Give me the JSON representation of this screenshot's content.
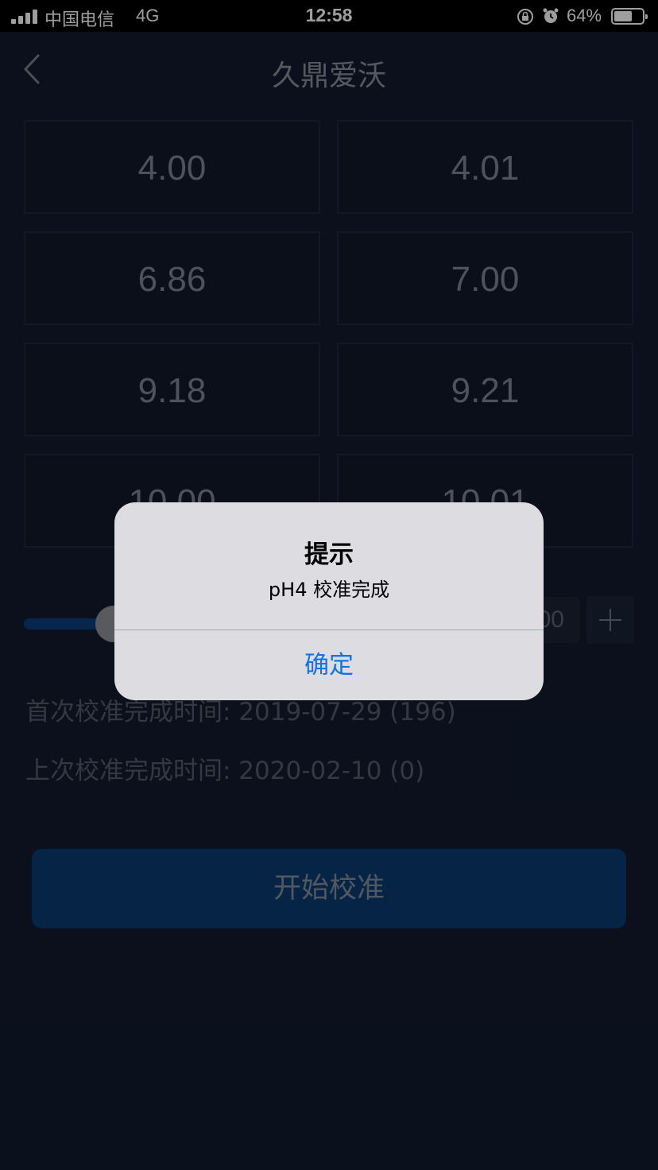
{
  "status_bar": {
    "carrier": "中国电信",
    "network": "4G",
    "time": "12:58",
    "battery_pct_text": "64%",
    "battery_level": 0.64
  },
  "nav": {
    "title": "久鼎爱沃"
  },
  "buffers": [
    "4.00",
    "4.01",
    "6.86",
    "7.00",
    "9.18",
    "9.21",
    "10.00",
    "10.01"
  ],
  "slider": {
    "value_text": "00"
  },
  "info": {
    "first_calibration": "首次校准完成时间: 2019-07-29 (196)",
    "last_calibration": "上次校准完成时间: 2020-02-10 (0)"
  },
  "start_button": {
    "label": "开始校准"
  },
  "dialog": {
    "title": "提示",
    "message": "pH4 校准完成",
    "confirm_label": "确定"
  },
  "colors": {
    "background": "#121a2e",
    "accent": "#0a3a72",
    "dialog_action": "#1672e0"
  }
}
